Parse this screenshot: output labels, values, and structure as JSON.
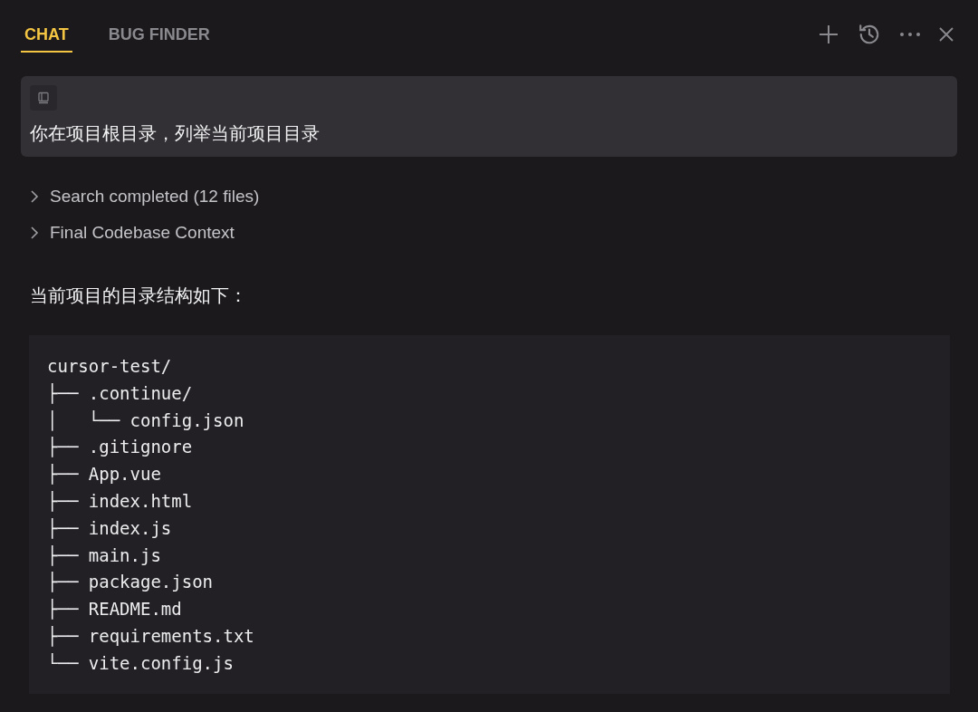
{
  "tabs": [
    {
      "label": "CHAT",
      "selected": true
    },
    {
      "label": "BUG FINDER",
      "selected": false
    }
  ],
  "message": {
    "text": "你在项目根目录，列举当前项目目录"
  },
  "steps": [
    {
      "label": "Search completed (12 files)",
      "expanded": false
    },
    {
      "label": "Final Codebase Context",
      "expanded": false
    }
  ],
  "answer": {
    "text": "当前项目的目录结构如下：",
    "code_lines": [
      "cursor-test/",
      "├── .continue/",
      "│   └── config.json",
      "├── .gitignore",
      "├── App.vue",
      "├── index.html",
      "├── index.js",
      "├── main.js",
      "├── package.json",
      "├── README.md",
      "├── requirements.txt",
      "└── vite.config.js"
    ]
  }
}
